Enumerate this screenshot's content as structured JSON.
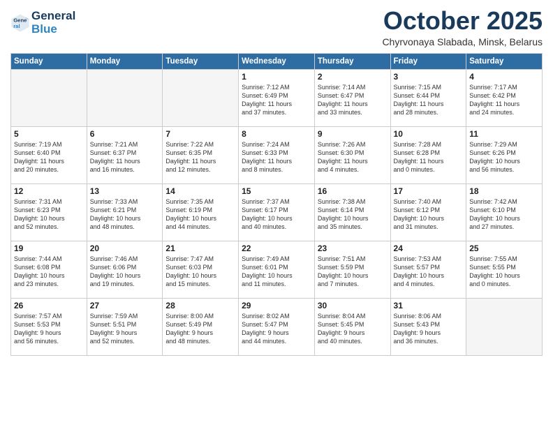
{
  "header": {
    "logo_line1": "General",
    "logo_line2": "Blue",
    "month": "October 2025",
    "location": "Chyrvonaya Slabada, Minsk, Belarus"
  },
  "weekdays": [
    "Sunday",
    "Monday",
    "Tuesday",
    "Wednesday",
    "Thursday",
    "Friday",
    "Saturday"
  ],
  "weeks": [
    [
      {
        "day": "",
        "info": "",
        "empty": true
      },
      {
        "day": "",
        "info": "",
        "empty": true
      },
      {
        "day": "",
        "info": "",
        "empty": true
      },
      {
        "day": "1",
        "info": "Sunrise: 7:12 AM\nSunset: 6:49 PM\nDaylight: 11 hours\nand 37 minutes.",
        "empty": false
      },
      {
        "day": "2",
        "info": "Sunrise: 7:14 AM\nSunset: 6:47 PM\nDaylight: 11 hours\nand 33 minutes.",
        "empty": false
      },
      {
        "day": "3",
        "info": "Sunrise: 7:15 AM\nSunset: 6:44 PM\nDaylight: 11 hours\nand 28 minutes.",
        "empty": false
      },
      {
        "day": "4",
        "info": "Sunrise: 7:17 AM\nSunset: 6:42 PM\nDaylight: 11 hours\nand 24 minutes.",
        "empty": false
      }
    ],
    [
      {
        "day": "5",
        "info": "Sunrise: 7:19 AM\nSunset: 6:40 PM\nDaylight: 11 hours\nand 20 minutes.",
        "empty": false
      },
      {
        "day": "6",
        "info": "Sunrise: 7:21 AM\nSunset: 6:37 PM\nDaylight: 11 hours\nand 16 minutes.",
        "empty": false
      },
      {
        "day": "7",
        "info": "Sunrise: 7:22 AM\nSunset: 6:35 PM\nDaylight: 11 hours\nand 12 minutes.",
        "empty": false
      },
      {
        "day": "8",
        "info": "Sunrise: 7:24 AM\nSunset: 6:33 PM\nDaylight: 11 hours\nand 8 minutes.",
        "empty": false
      },
      {
        "day": "9",
        "info": "Sunrise: 7:26 AM\nSunset: 6:30 PM\nDaylight: 11 hours\nand 4 minutes.",
        "empty": false
      },
      {
        "day": "10",
        "info": "Sunrise: 7:28 AM\nSunset: 6:28 PM\nDaylight: 11 hours\nand 0 minutes.",
        "empty": false
      },
      {
        "day": "11",
        "info": "Sunrise: 7:29 AM\nSunset: 6:26 PM\nDaylight: 10 hours\nand 56 minutes.",
        "empty": false
      }
    ],
    [
      {
        "day": "12",
        "info": "Sunrise: 7:31 AM\nSunset: 6:23 PM\nDaylight: 10 hours\nand 52 minutes.",
        "empty": false
      },
      {
        "day": "13",
        "info": "Sunrise: 7:33 AM\nSunset: 6:21 PM\nDaylight: 10 hours\nand 48 minutes.",
        "empty": false
      },
      {
        "day": "14",
        "info": "Sunrise: 7:35 AM\nSunset: 6:19 PM\nDaylight: 10 hours\nand 44 minutes.",
        "empty": false
      },
      {
        "day": "15",
        "info": "Sunrise: 7:37 AM\nSunset: 6:17 PM\nDaylight: 10 hours\nand 40 minutes.",
        "empty": false
      },
      {
        "day": "16",
        "info": "Sunrise: 7:38 AM\nSunset: 6:14 PM\nDaylight: 10 hours\nand 35 minutes.",
        "empty": false
      },
      {
        "day": "17",
        "info": "Sunrise: 7:40 AM\nSunset: 6:12 PM\nDaylight: 10 hours\nand 31 minutes.",
        "empty": false
      },
      {
        "day": "18",
        "info": "Sunrise: 7:42 AM\nSunset: 6:10 PM\nDaylight: 10 hours\nand 27 minutes.",
        "empty": false
      }
    ],
    [
      {
        "day": "19",
        "info": "Sunrise: 7:44 AM\nSunset: 6:08 PM\nDaylight: 10 hours\nand 23 minutes.",
        "empty": false
      },
      {
        "day": "20",
        "info": "Sunrise: 7:46 AM\nSunset: 6:06 PM\nDaylight: 10 hours\nand 19 minutes.",
        "empty": false
      },
      {
        "day": "21",
        "info": "Sunrise: 7:47 AM\nSunset: 6:03 PM\nDaylight: 10 hours\nand 15 minutes.",
        "empty": false
      },
      {
        "day": "22",
        "info": "Sunrise: 7:49 AM\nSunset: 6:01 PM\nDaylight: 10 hours\nand 11 minutes.",
        "empty": false
      },
      {
        "day": "23",
        "info": "Sunrise: 7:51 AM\nSunset: 5:59 PM\nDaylight: 10 hours\nand 7 minutes.",
        "empty": false
      },
      {
        "day": "24",
        "info": "Sunrise: 7:53 AM\nSunset: 5:57 PM\nDaylight: 10 hours\nand 4 minutes.",
        "empty": false
      },
      {
        "day": "25",
        "info": "Sunrise: 7:55 AM\nSunset: 5:55 PM\nDaylight: 10 hours\nand 0 minutes.",
        "empty": false
      }
    ],
    [
      {
        "day": "26",
        "info": "Sunrise: 7:57 AM\nSunset: 5:53 PM\nDaylight: 9 hours\nand 56 minutes.",
        "empty": false
      },
      {
        "day": "27",
        "info": "Sunrise: 7:59 AM\nSunset: 5:51 PM\nDaylight: 9 hours\nand 52 minutes.",
        "empty": false
      },
      {
        "day": "28",
        "info": "Sunrise: 8:00 AM\nSunset: 5:49 PM\nDaylight: 9 hours\nand 48 minutes.",
        "empty": false
      },
      {
        "day": "29",
        "info": "Sunrise: 8:02 AM\nSunset: 5:47 PM\nDaylight: 9 hours\nand 44 minutes.",
        "empty": false
      },
      {
        "day": "30",
        "info": "Sunrise: 8:04 AM\nSunset: 5:45 PM\nDaylight: 9 hours\nand 40 minutes.",
        "empty": false
      },
      {
        "day": "31",
        "info": "Sunrise: 8:06 AM\nSunset: 5:43 PM\nDaylight: 9 hours\nand 36 minutes.",
        "empty": false
      },
      {
        "day": "",
        "info": "",
        "empty": true
      }
    ]
  ]
}
